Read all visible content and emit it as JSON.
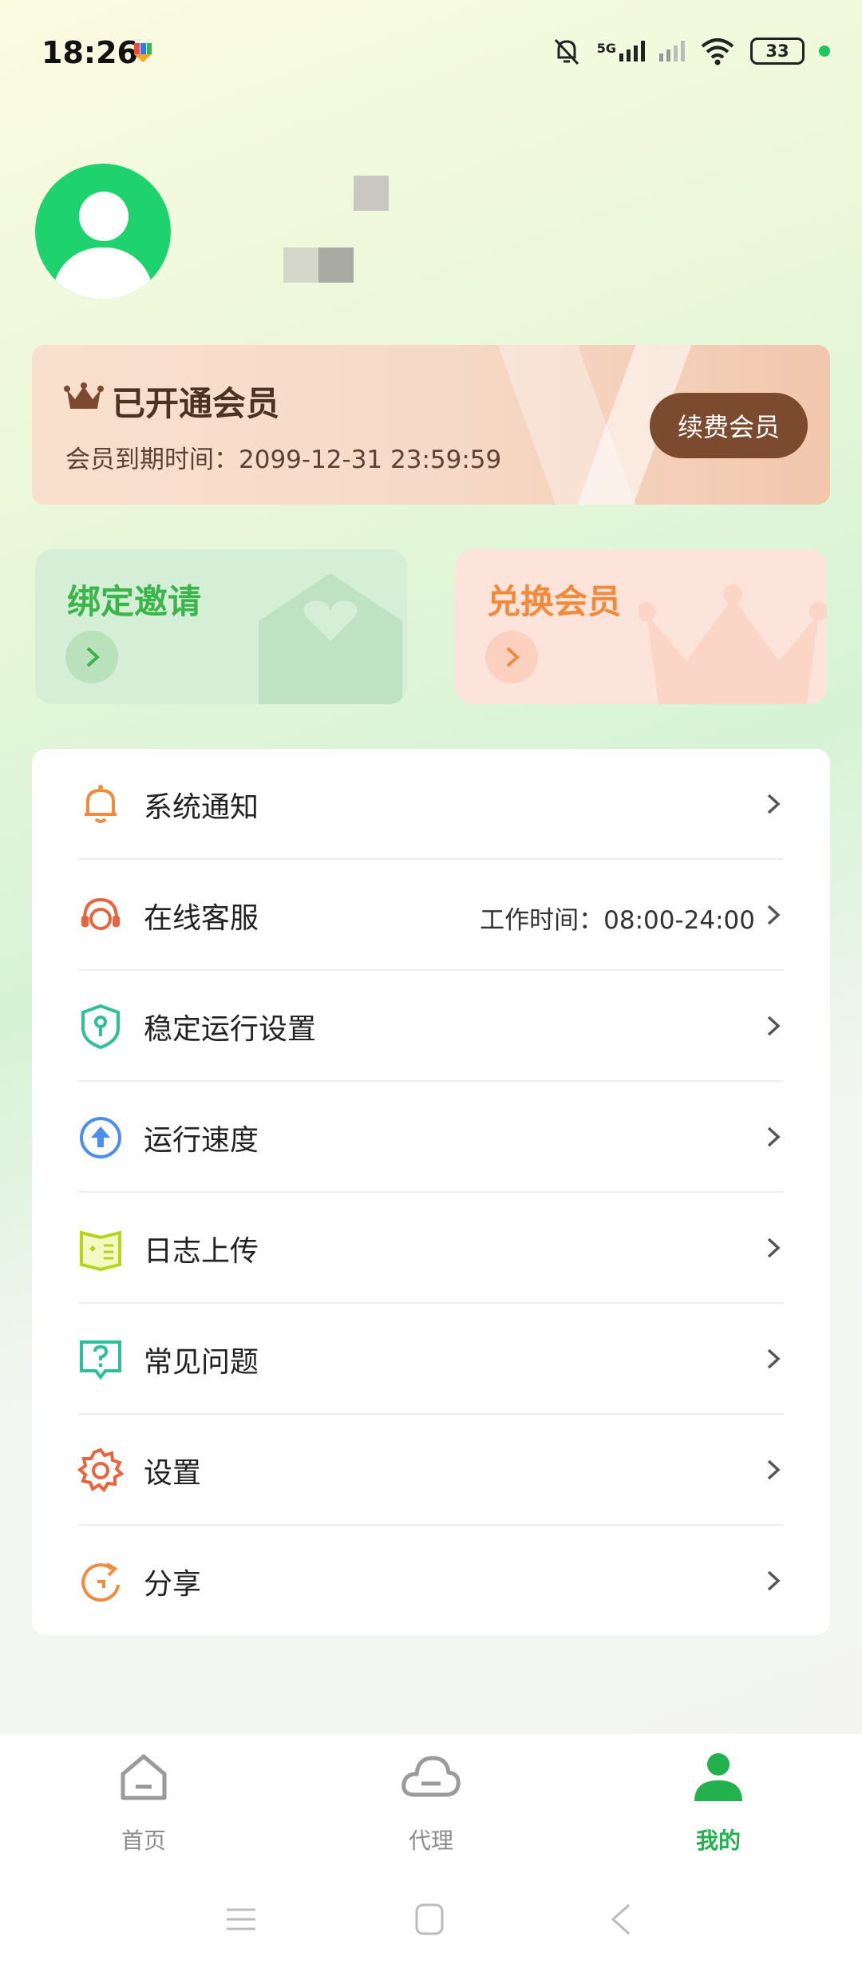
{
  "status_bar": {
    "time": "18:26",
    "network": "5G",
    "battery": "33"
  },
  "membership": {
    "title": "已开通会员",
    "expire_text": "会员到期时间：2099-12-31 23:59:59",
    "renew_label": "续费会员"
  },
  "quick_cards": {
    "bind": {
      "title": "绑定邀请",
      "color": "#3bb44a"
    },
    "exchange": {
      "title": "兑换会员",
      "color": "#f08a3c"
    }
  },
  "menu": {
    "items": [
      {
        "label": "系统通知",
        "icon": "bell-icon"
      },
      {
        "label": "在线客服",
        "icon": "headset-icon",
        "extra": "工作时间：08:00-24:00"
      },
      {
        "label": "稳定运行设置",
        "icon": "shield-key-icon"
      },
      {
        "label": "运行速度",
        "icon": "speed-up-icon"
      },
      {
        "label": "日志上传",
        "icon": "log-book-icon"
      },
      {
        "label": "常见问题",
        "icon": "question-icon"
      },
      {
        "label": "设置",
        "icon": "gear-icon"
      },
      {
        "label": "分享",
        "icon": "share-icon"
      }
    ]
  },
  "tabs": [
    {
      "label": "首页",
      "icon": "home-icon",
      "active": false
    },
    {
      "label": "代理",
      "icon": "cloud-icon",
      "active": false
    },
    {
      "label": "我的",
      "icon": "user-icon",
      "active": true
    }
  ],
  "colors": {
    "accent": "#22b14c",
    "brown": "#7c4a2e"
  }
}
